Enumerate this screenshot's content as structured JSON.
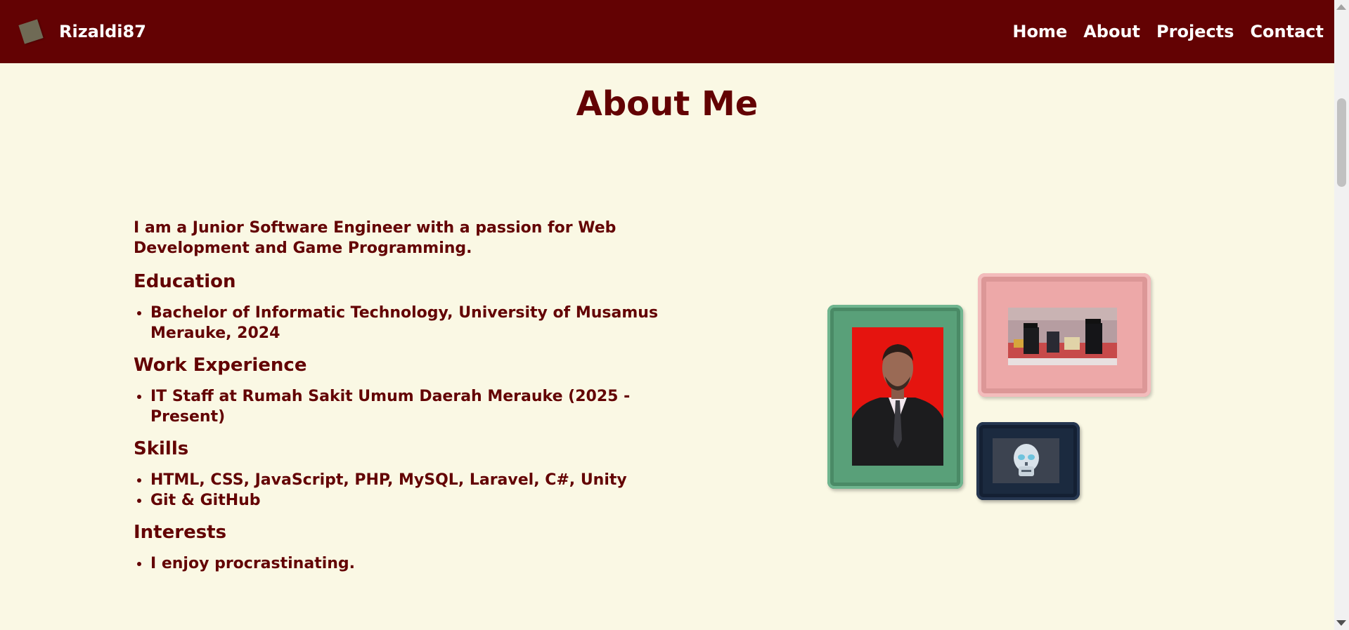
{
  "nav": {
    "brand": "Rizaldi87",
    "links": [
      "Home",
      "About",
      "Projects",
      "Contact"
    ]
  },
  "page": {
    "title": "About Me",
    "intro": "I am a Junior Software Engineer with a passion for Web Development and Game Programming.",
    "sections": [
      {
        "heading": "Education",
        "items": [
          "Bachelor of Informatic Technology, University of Musamus Merauke, 2024"
        ]
      },
      {
        "heading": "Work Experience",
        "items": [
          "IT Staff at Rumah Sakit Umum Daerah Merauke (2025 - Present)"
        ]
      },
      {
        "heading": "Skills",
        "items": [
          "HTML, CSS, JavaScript, PHP, MySQL, Laravel, C#, Unity",
          "Git & GitHub"
        ]
      },
      {
        "heading": "Interests",
        "items": [
          "I enjoy procrastinating."
        ]
      }
    ]
  },
  "colors": {
    "navbar": "#630203",
    "background": "#faf8e4",
    "text": "#630203",
    "frame_green": "#59a079",
    "frame_pink": "#eda8a8",
    "frame_navy": "#1b2a3f"
  }
}
